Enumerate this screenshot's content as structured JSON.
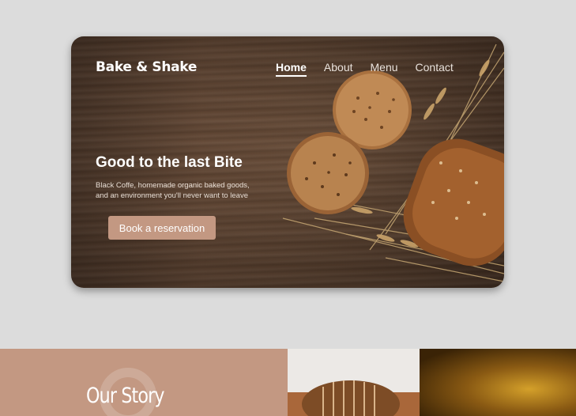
{
  "hero": {
    "brand": "Bake & Shake",
    "nav": [
      {
        "label": "Home",
        "active": true
      },
      {
        "label": "About",
        "active": false
      },
      {
        "label": "Menu",
        "active": false
      },
      {
        "label": "Contact",
        "active": false
      }
    ],
    "headline": "Good to the last Bite",
    "subtext": "Black Coffe, homemade organic baked goods, and an environment you'll never want to leave",
    "cta_label": "Book a reservation"
  },
  "story": {
    "title": "Our Story"
  },
  "colors": {
    "accent": "#c39882",
    "page_bg": "#dcdcdc",
    "wood": "#6c4d38"
  }
}
